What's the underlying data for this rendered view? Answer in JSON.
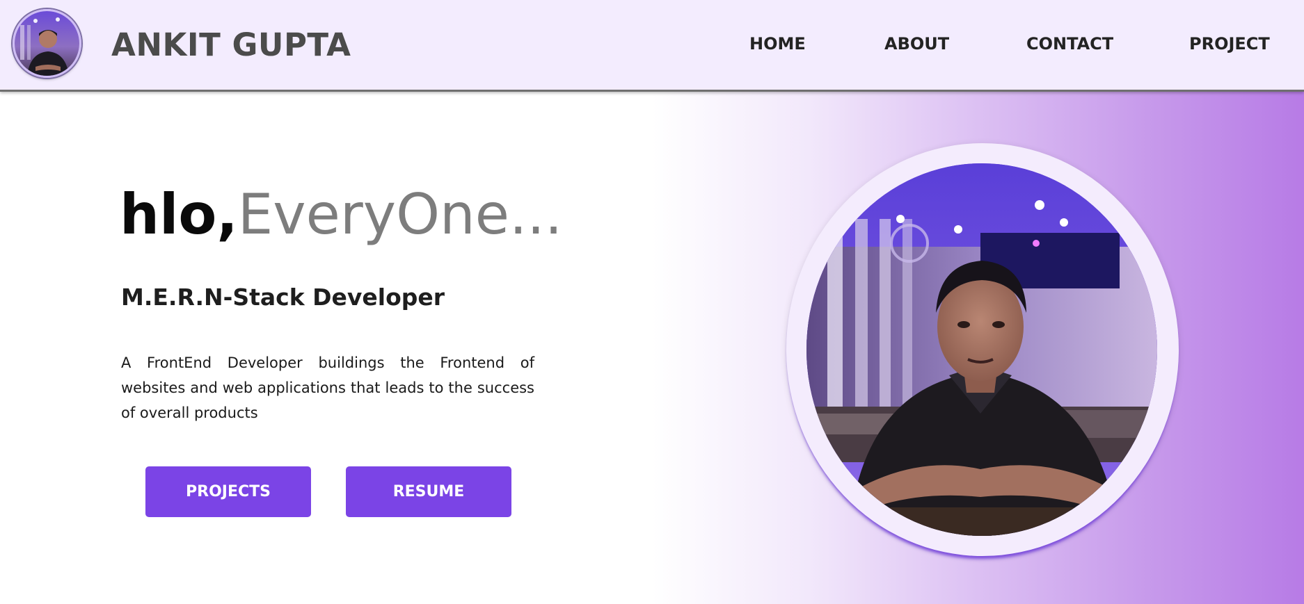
{
  "header": {
    "brand": "ANKIT GUPTA",
    "nav": [
      "HOME",
      "ABOUT",
      "CONTACT",
      "PROJECT"
    ]
  },
  "hero": {
    "greeting_hello": "hlo",
    "greeting_comma": ",",
    "greeting_rest": "EveryOne...",
    "role": "M.E.R.N-Stack Developer",
    "description": "A FrontEnd Developer buildings the Frontend of websites and web applications that leads to the success of overall products",
    "buttons": {
      "projects": "PROJECTS",
      "resume": "RESUME"
    }
  },
  "colors": {
    "header_bg": "#f3ecfe",
    "accent": "#7b44e6",
    "gradient_end": "#b77be6"
  }
}
